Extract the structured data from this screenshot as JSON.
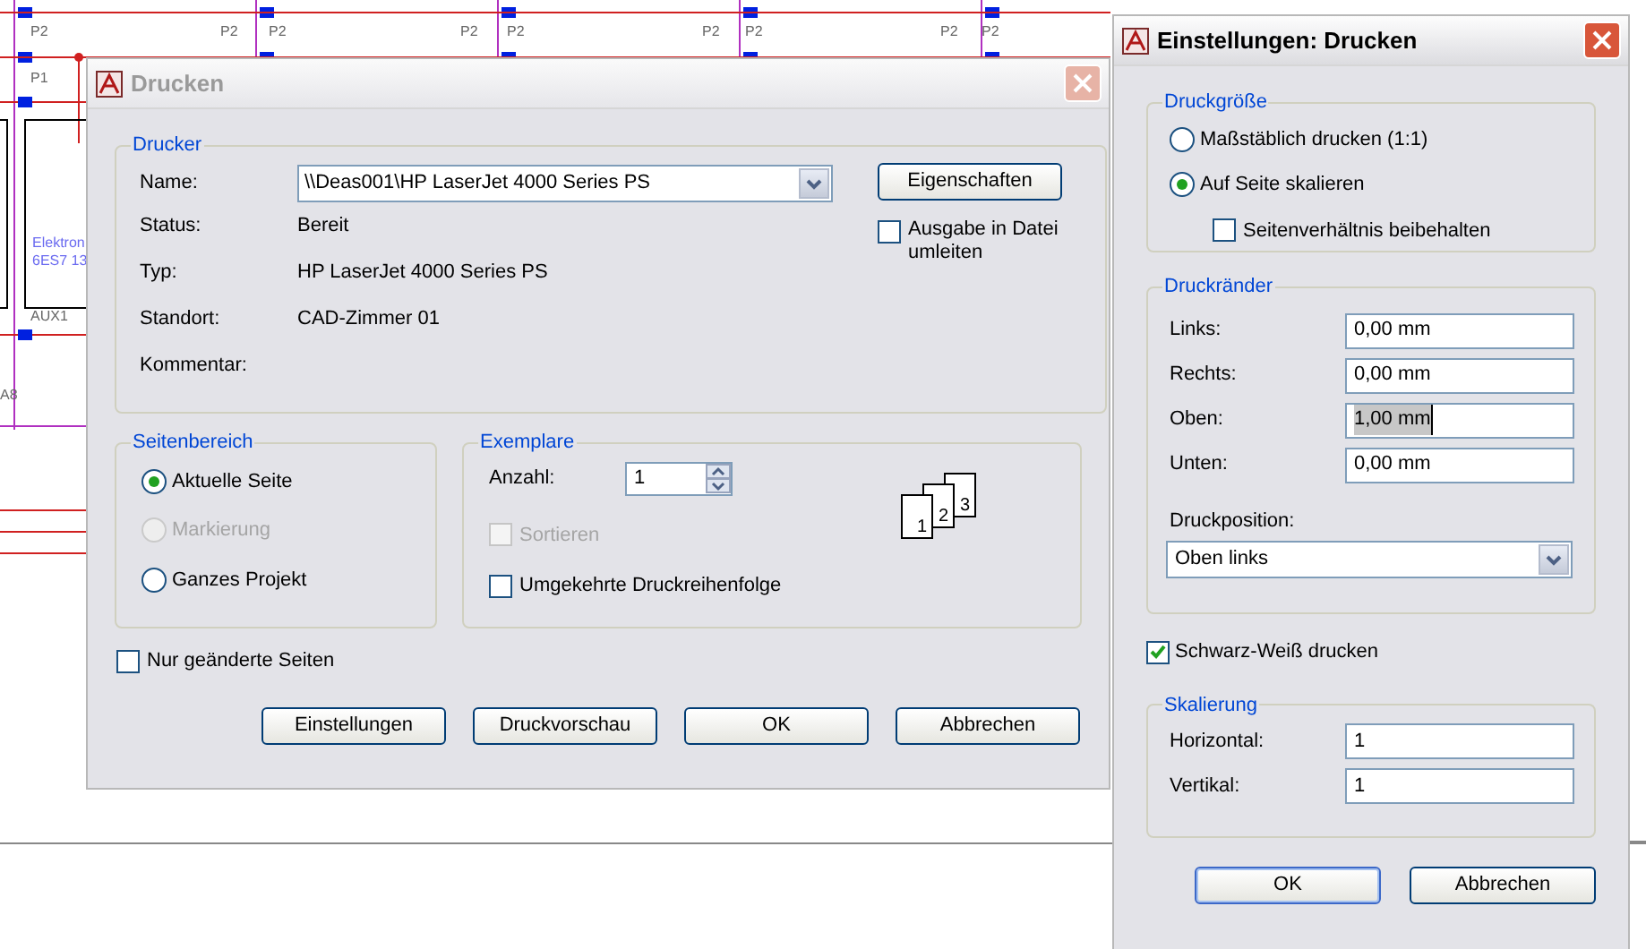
{
  "schematic": {
    "labels": [
      "P2",
      "P2",
      "P2",
      "P2",
      "P2",
      "P2",
      "P2",
      "P2",
      "P2",
      "P1",
      "Elektron",
      "6ES7 13",
      "AUX1",
      "A8"
    ]
  },
  "print_dialog": {
    "title": "Drucken",
    "active": false,
    "printer": {
      "title": "Drucker",
      "name_label": "Name:",
      "name_value": "\\\\Deas001\\HP LaserJet 4000 Series PS",
      "properties_button": "Eigenschaften",
      "info": [
        {
          "label": "Status:",
          "value": "Bereit"
        },
        {
          "label": "Typ:",
          "value": "HP LaserJet 4000 Series PS"
        },
        {
          "label": "Standort:",
          "value": "CAD-Zimmer 01"
        },
        {
          "label": "Kommentar:"
        }
      ],
      "file_output": {
        "label": "Ausgabe in Datei umleiten",
        "checked": false
      }
    },
    "page_range": {
      "title": "Seitenbereich",
      "options": [
        {
          "label": "Aktuelle Seite",
          "selected": true,
          "disabled": false
        },
        {
          "label": "Markierung",
          "selected": false,
          "disabled": true
        },
        {
          "label": "Ganzes Projekt",
          "selected": false,
          "disabled": false
        }
      ]
    },
    "copies": {
      "title": "Exemplare",
      "count_label": "Anzahl:",
      "count": "1",
      "page_numbers": [
        "1",
        "2",
        "3"
      ],
      "options": [
        {
          "label": "Sortieren",
          "checked": false,
          "disabled": true
        },
        {
          "label": "Umgekehrte Druckreihenfolge",
          "checked": false,
          "disabled": false
        }
      ]
    },
    "only_changed": {
      "label": "Nur geänderte Seiten",
      "checked": false
    },
    "buttons": [
      "Einstellungen",
      "Druckvorschau",
      "OK",
      "Abbrechen"
    ]
  },
  "settings_dialog": {
    "title": "Einstellungen: Drucken",
    "active": true,
    "size": {
      "title": "Druckgröße",
      "options": [
        {
          "label": "Maßstäblich drucken (1:1)",
          "selected": false
        },
        {
          "label": "Auf Seite skalieren",
          "selected": true
        }
      ],
      "keep_ratio": {
        "label": "Seitenverhältnis beibehalten",
        "checked": false
      }
    },
    "margins": {
      "title": "Druckränder",
      "fields": [
        {
          "label": "Links:",
          "value": "0,00 mm",
          "focused": false
        },
        {
          "label": "Rechts:",
          "value": "0,00 mm",
          "focused": false
        },
        {
          "label": "Oben:",
          "value": "1,00 mm",
          "focused": true
        },
        {
          "label": "Unten:",
          "value": "0,00 mm",
          "focused": false
        }
      ],
      "position_label": "Druckposition:",
      "position_value": "Oben links"
    },
    "black_white": {
      "label": "Schwarz-Weiß drucken",
      "checked": true
    },
    "scaling": {
      "title": "Skalierung",
      "fields": [
        {
          "label": "Horizontal:",
          "value": "1",
          "focused": false
        },
        {
          "label": "Vertikal:",
          "value": "1",
          "focused": false
        }
      ]
    },
    "buttons": [
      {
        "label": "OK",
        "default": true
      },
      {
        "label": "Abbrechen",
        "default": false
      }
    ]
  }
}
